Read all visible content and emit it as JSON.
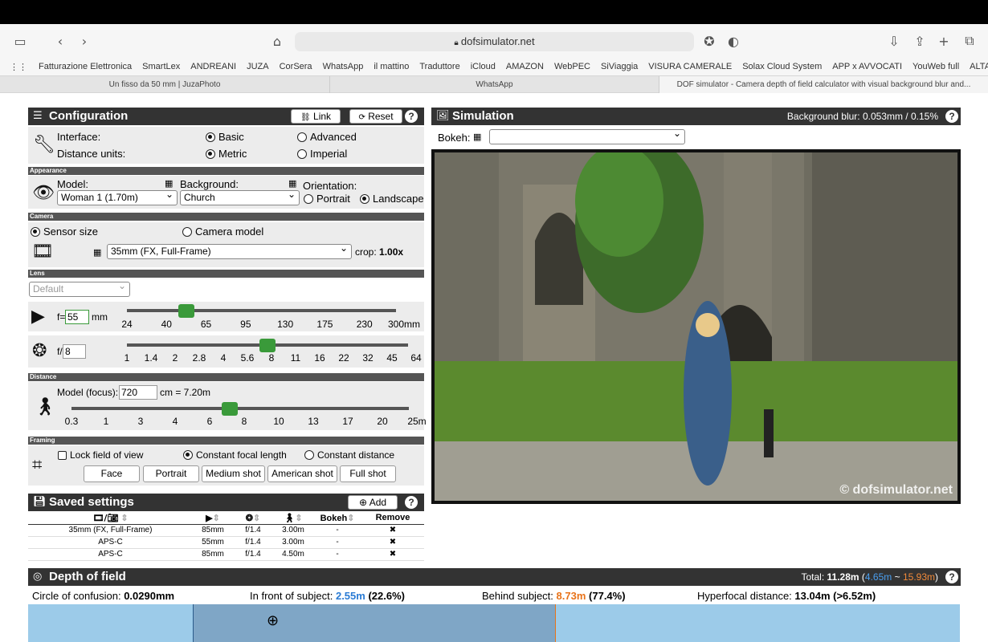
{
  "browser": {
    "url": "dofsimulator.net",
    "favorites": [
      "Fatturazione Elettronica",
      "SmartLex",
      "ANDREANI",
      "JUZA",
      "CorSera",
      "WhatsApp",
      "il mattino",
      "Traduttore",
      "iCloud",
      "AMAZON",
      "WebPEC",
      "SiViaggia",
      "VISURA CAMERALE",
      "Solax Cloud System",
      "APP x AVVOCATI",
      "YouWeb full",
      "ALTALEX"
    ],
    "tabs": [
      {
        "label": "Un fisso da 50 mm | JuzaPhoto"
      },
      {
        "label": "WhatsApp"
      },
      {
        "label": "DOF simulator - Camera depth of field calculator with visual background blur and..."
      }
    ]
  },
  "configuration": {
    "title": "Configuration",
    "link_label": "Link",
    "reset_label": "Reset",
    "interface_label": "Interface:",
    "interface_basic": "Basic",
    "interface_advanced": "Advanced",
    "units_label": "Distance units:",
    "units_metric": "Metric",
    "units_imperial": "Imperial"
  },
  "appearance": {
    "section": "Appearance",
    "model_label": "Model:",
    "model_value": "Woman 1 (1.70m)",
    "background_label": "Background:",
    "background_value": "Church",
    "orientation_label": "Orientation:",
    "portrait": "Portrait",
    "landscape": "Landscape"
  },
  "camera": {
    "section": "Camera",
    "sensor_size": "Sensor size",
    "camera_model": "Camera model",
    "sensor_value": "35mm (FX, Full-Frame)",
    "crop_label": "crop:",
    "crop_value": "1.00x"
  },
  "lens": {
    "section": "Lens",
    "lens_value": "Default",
    "focal_prefix": "f=",
    "focal_value": "55",
    "focal_unit": "mm",
    "focal_ticks": [
      "24",
      "40",
      "65",
      "95",
      "130",
      "175",
      "230",
      "300mm"
    ],
    "focal_slider_fraction": 0.22,
    "aperture_prefix": "f/",
    "aperture_value": "8",
    "aperture_ticks": [
      "1",
      "1.4",
      "2",
      "2.8",
      "4",
      "5.6",
      "8",
      "11",
      "16",
      "22",
      "32",
      "45",
      "64"
    ],
    "aperture_slider_fraction": 0.5
  },
  "distance": {
    "section": "Distance",
    "focus_label": "Model (focus):",
    "focus_value": "720",
    "focus_conv": "cm = 7.20m",
    "ticks": [
      "0.3",
      "1",
      "3",
      "4",
      "6",
      "8",
      "10",
      "13",
      "17",
      "20",
      "25m"
    ],
    "slider_fraction": 0.47
  },
  "framing": {
    "section": "Framing",
    "lock_fov": "Lock field of view",
    "constant_focal": "Constant focal length",
    "constant_distance": "Constant distance",
    "buttons": [
      "Face",
      "Portrait",
      "Medium shot",
      "American shot",
      "Full shot"
    ]
  },
  "saved": {
    "title": "Saved settings",
    "add_label": "Add",
    "col_bokeh": "Bokeh",
    "col_remove": "Remove",
    "rows": [
      {
        "sensor": "35mm (FX, Full-Frame)",
        "focal": "85mm",
        "aperture": "f/1.4",
        "distance": "3.00m",
        "bokeh": "-",
        "remove": "✖"
      },
      {
        "sensor": "APS-C",
        "focal": "55mm",
        "aperture": "f/1.4",
        "distance": "3.00m",
        "bokeh": "-",
        "remove": "✖"
      },
      {
        "sensor": "APS-C",
        "focal": "85mm",
        "aperture": "f/1.4",
        "distance": "4.50m",
        "bokeh": "-",
        "remove": "✖"
      }
    ]
  },
  "simulation": {
    "title": "Simulation",
    "blur_label": "Background blur: 0.053mm / 0.15%",
    "bokeh_label": "Bokeh:",
    "watermark": "© dofsimulator.net"
  },
  "dof": {
    "title": "Depth of field",
    "total_label": "Total:",
    "total_value": "11.28m",
    "total_near": "4.65m",
    "total_sep": "~",
    "total_far": "15.93m",
    "coc_label": "Circle of confusion:",
    "coc_value": "0.0290mm",
    "front_label": "In front of subject:",
    "front_value": "2.55m",
    "front_pct": "(22.6%)",
    "behind_label": "Behind subject:",
    "behind_value": "8.73m",
    "behind_pct": "(77.4%)",
    "hyperfocal_label": "Hyperfocal distance:",
    "hyperfocal_value": "13.04m (>6.52m)"
  },
  "colors": {
    "accent_green": "#3a9a3a",
    "near_blue": "#2a7bd4",
    "far_orange": "#e8731a",
    "header_dark": "#333333"
  }
}
